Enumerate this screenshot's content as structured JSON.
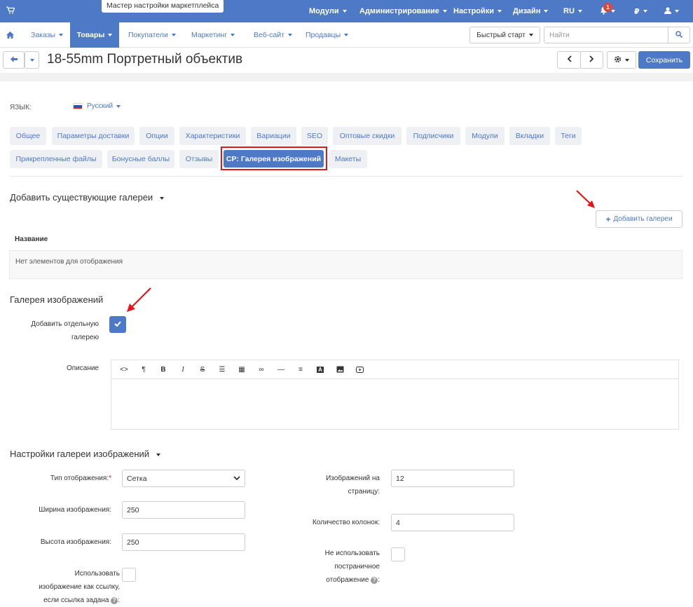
{
  "topbar": {
    "wizard": "Мастер настройки маркетплейса",
    "menu": [
      "Модули",
      "Администрирование",
      "Настройки",
      "Дизайн",
      "RU"
    ],
    "notifications": "1",
    "currency": "₽"
  },
  "nav": {
    "items": [
      "Заказы",
      "Товары",
      "Покупатели",
      "Маркетинг",
      "Веб-сайт",
      "Продавцы"
    ],
    "active": "Товары",
    "quickstart": "Быстрый старт",
    "search_placeholder": "Найти"
  },
  "page": {
    "title": "18-55mm Портретный объектив",
    "save": "Сохранить"
  },
  "language": {
    "label": "ЯЗЫК:",
    "value": "Русский"
  },
  "tabs_row1": [
    "Общее",
    "Параметры доставки",
    "Опции",
    "Характеристики",
    "Вариации",
    "SEO",
    "Оптовые скидки",
    "Подписчики",
    "Модули",
    "Вкладки",
    "Теги"
  ],
  "tabs_row2": [
    "Прикрепленные файлы",
    "Бонусные баллы",
    "Отзывы",
    "CP: Галерея изображений",
    "Макеты"
  ],
  "existing": {
    "heading": "Добавить существующие галереи",
    "add_button": "Добавить галереи",
    "col_name": "Название",
    "empty": "Нет элементов для отображения"
  },
  "gallery": {
    "heading": "Галерея изображений",
    "separate_label_1": "Добавить отдельную",
    "separate_label_2": "галерею",
    "separate_checked": true,
    "description_label": "Описание"
  },
  "settings": {
    "heading": "Настройки галереи изображений",
    "display_type_label": "Тип отображения:",
    "display_type_value": "Сетка",
    "width_label": "Ширина изображения:",
    "width_value": "250",
    "height_label": "Высота изображения:",
    "height_value": "250",
    "link_label_1": "Использовать",
    "link_label_2": "изображение как ссылку,",
    "link_label_3": "если ссылка задана",
    "per_page_label_1": "Изображений на",
    "per_page_label_2": "страницу:",
    "per_page_value": "12",
    "columns_label": "Количество колонок:",
    "columns_value": "4",
    "no_paging_label_1": "Не использовать",
    "no_paging_label_2": "постраничное",
    "no_paging_label_3": "отображение"
  },
  "colors": {
    "accent": "#4d79c7",
    "highlight": "#e3161b"
  }
}
